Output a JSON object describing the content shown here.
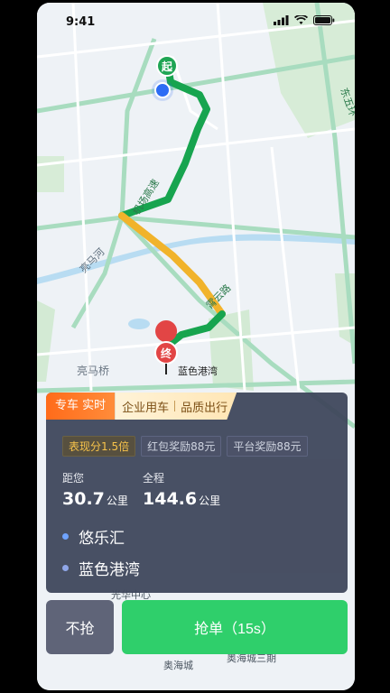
{
  "status_bar": {
    "time": "9:41"
  },
  "map": {
    "start_marker": "起",
    "end_marker": "终",
    "destination_label": "蓝色港湾",
    "road_labels": [
      "机场高速",
      "霄云路",
      "亮马河",
      "亮马桥",
      "东五环"
    ],
    "bottom_labels": [
      "光华中心",
      "奥海城",
      "奥海城三期"
    ],
    "colors": {
      "route_green": "#17a44f",
      "route_yellow": "#f1b32b",
      "user_dot": "#2d6cf5",
      "marker_red": "#e24545",
      "marker_green": "#1fa554"
    }
  },
  "order_card": {
    "tab_active": "专车 实时",
    "tab_corp": "企业用车",
    "tab_quality": "品质出行",
    "tags": [
      "表现分1.5倍",
      "红包奖励88元",
      "平台奖励88元"
    ],
    "pickup_label": "距您",
    "pickup_value": "30.7",
    "pickup_unit": "公里",
    "total_label": "全程",
    "total_value": "144.6",
    "total_unit": "公里",
    "origin": "悠乐汇",
    "destination": "蓝色港湾"
  },
  "actions": {
    "skip": "不抢",
    "grab": "抢单（15s）"
  }
}
